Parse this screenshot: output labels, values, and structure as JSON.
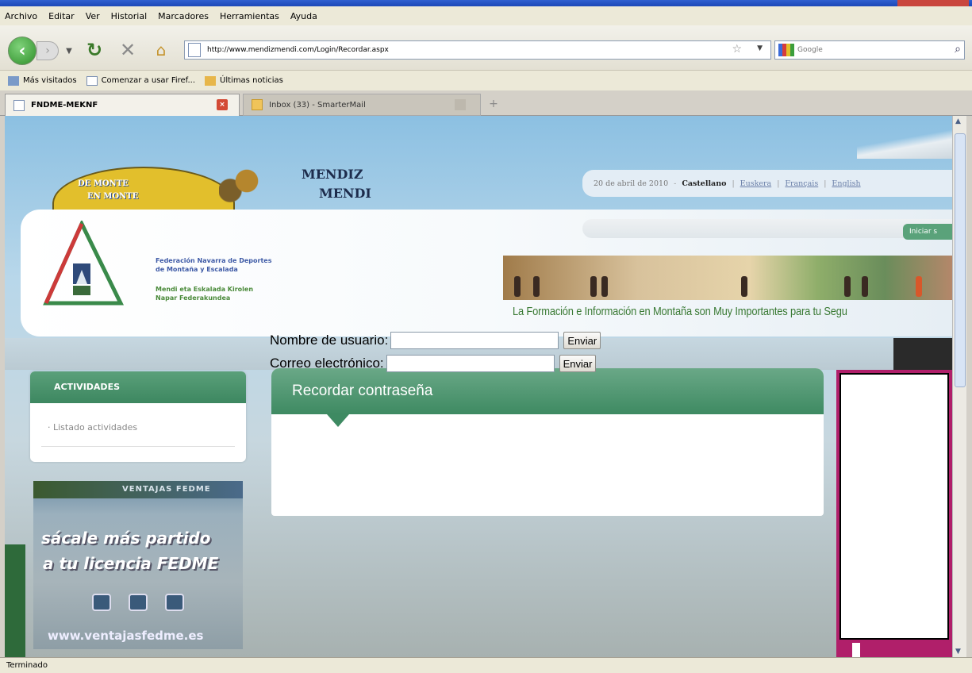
{
  "browser": {
    "menu": [
      "Archivo",
      "Editar",
      "Ver",
      "Historial",
      "Marcadores",
      "Herramientas",
      "Ayuda"
    ],
    "url": "http://www.mendizmendi.com/Login/Recordar.aspx",
    "search_placeholder": "Google",
    "bookmarks": [
      "Más visitados",
      "Comenzar a usar Firef...",
      "Últimas noticias"
    ],
    "tabs": [
      {
        "title": "FNDME-MEKNF"
      },
      {
        "title": "Inbox (33) - SmarterMail"
      }
    ],
    "status": "Terminado"
  },
  "site": {
    "mendi_logo": {
      "line1": "DE MONTE",
      "line2": "EN MONTE",
      "mendiz": "MENDIZ",
      "mendi": "MENDI"
    },
    "date": "20 de abril de 2010",
    "languages": {
      "current": "Castellano",
      "euskera": "Euskera",
      "francais": "Français",
      "english": "English"
    },
    "login_button": "Iniciar s",
    "federation": {
      "l1": "Federación Navarra de Deportes",
      "l2": "de Montaña y Escalada",
      "l3": "Mendi eta Eskalada Kirolen",
      "l4": "Napar Federakundea"
    },
    "banner_caption": "La Formación e Información en Montaña son Muy Importantes para tu Segu"
  },
  "sidebar": {
    "activities_title": "ACTIVIDADES",
    "activities_item": "Listado actividades",
    "fedme": {
      "top": "VENTAJAS FEDME",
      "big1": "sácale más partido",
      "big2": "a tu licencia FEDME",
      "url": "www.ventajasfedme.es"
    }
  },
  "main": {
    "title": "Recordar contraseña",
    "user_label": "Nombre de usuario:",
    "email_label": "Correo electrónico:",
    "send_label": "Enviar"
  },
  "colors": {
    "accent_green": "#3e8a62",
    "ad_border": "#b01f6a"
  }
}
